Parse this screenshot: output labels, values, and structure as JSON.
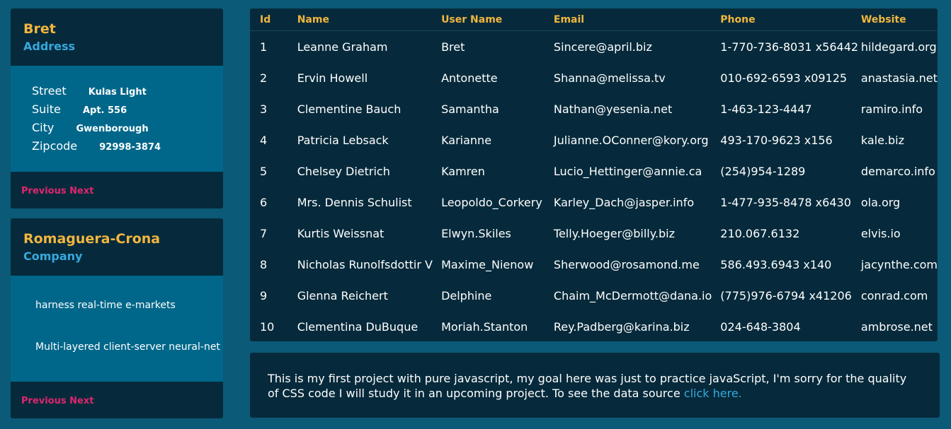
{
  "address_card": {
    "title": "Bret",
    "subtitle": "Address",
    "rows": [
      {
        "label": "Street",
        "value": "Kulas Light"
      },
      {
        "label": "Suite",
        "value": "Apt. 556"
      },
      {
        "label": "City",
        "value": "Gwenborough"
      },
      {
        "label": "Zipcode",
        "value": "92998-3874"
      }
    ],
    "prev": "Previous",
    "next": "Next"
  },
  "company_card": {
    "title": "Romaguera-Crona",
    "subtitle": "Company",
    "lines": [
      "harness real-time e-markets",
      "Multi-layered client-server neural-net"
    ],
    "prev": "Previous",
    "next": "Next"
  },
  "table": {
    "headers": [
      "Id",
      "Name",
      "User Name",
      "Email",
      "Phone",
      "Website"
    ],
    "rows": [
      [
        "1",
        "Leanne Graham",
        "Bret",
        "Sincere@april.biz",
        "1-770-736-8031 x56442",
        "hildegard.org"
      ],
      [
        "2",
        "Ervin Howell",
        "Antonette",
        "Shanna@melissa.tv",
        "010-692-6593 x09125",
        "anastasia.net"
      ],
      [
        "3",
        "Clementine Bauch",
        "Samantha",
        "Nathan@yesenia.net",
        "1-463-123-4447",
        "ramiro.info"
      ],
      [
        "4",
        "Patricia Lebsack",
        "Karianne",
        "Julianne.OConner@kory.org",
        "493-170-9623 x156",
        "kale.biz"
      ],
      [
        "5",
        "Chelsey Dietrich",
        "Kamren",
        "Lucio_Hettinger@annie.ca",
        "(254)954-1289",
        "demarco.info"
      ],
      [
        "6",
        "Mrs. Dennis Schulist",
        "Leopoldo_Corkery",
        "Karley_Dach@jasper.info",
        "1-477-935-8478 x6430",
        "ola.org"
      ],
      [
        "7",
        "Kurtis Weissnat",
        "Elwyn.Skiles",
        "Telly.Hoeger@billy.biz",
        "210.067.6132",
        "elvis.io"
      ],
      [
        "8",
        "Nicholas Runolfsdottir V",
        "Maxime_Nienow",
        "Sherwood@rosamond.me",
        "586.493.6943 x140",
        "jacynthe.com"
      ],
      [
        "9",
        "Glenna Reichert",
        "Delphine",
        "Chaim_McDermott@dana.io",
        "(775)976-6794 x41206",
        "conrad.com"
      ],
      [
        "10",
        "Clementina DuBuque",
        "Moriah.Stanton",
        "Rey.Padberg@karina.biz",
        "024-648-3804",
        "ambrose.net"
      ]
    ]
  },
  "note": {
    "text": "This is my first project with pure javascript, my goal here was just to practice javaScript, I'm sorry for the quality of CSS code I will study it in an upcoming project. To see the data source ",
    "link": "click here."
  },
  "colors": {
    "background": "#0b5a78",
    "panel": "#062a3b",
    "card_body": "#00678a",
    "accent_yellow": "#f2b63f",
    "accent_blue": "#36a9de",
    "accent_pink": "#e0256f"
  }
}
